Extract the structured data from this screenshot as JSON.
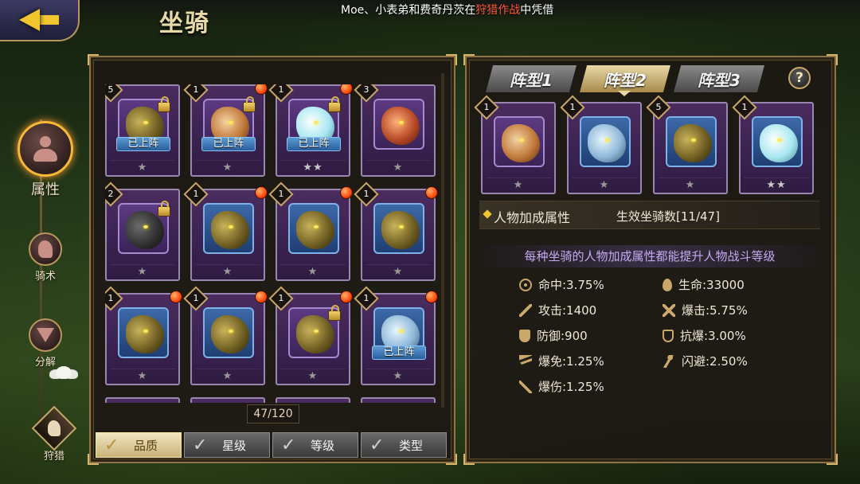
{
  "header": {
    "title": "坐骑",
    "marquee_parts": [
      "Moe、小表弟和费奇丹茨在",
      "狩猎作战",
      "中凭借"
    ]
  },
  "left_nav": [
    {
      "label": "属性",
      "icon": "person-icon",
      "active": true
    },
    {
      "label": "骑术",
      "icon": "horse-head-icon",
      "active": false
    },
    {
      "label": "分解",
      "icon": "decompose-icon",
      "active": false
    },
    {
      "label": "狩猎",
      "icon": "hunt-icon",
      "active": false
    }
  ],
  "mount_list": {
    "count": "47/120",
    "deployed_label": "已上阵",
    "cards": [
      {
        "level": "5",
        "beast": "dragon",
        "lock": true,
        "deployed": true,
        "red_dot": false,
        "stars": "★"
      },
      {
        "level": "1",
        "beast": "tiger",
        "lock": true,
        "deployed": true,
        "red_dot": true,
        "stars": "★"
      },
      {
        "level": "1",
        "beast": "unicorn",
        "lock": true,
        "deployed": true,
        "red_dot": true,
        "stars": "★★"
      },
      {
        "level": "3",
        "beast": "phoenix",
        "lock": false,
        "deployed": false,
        "red_dot": false,
        "stars": "★"
      },
      {
        "level": "2",
        "beast": "dragon-dark",
        "lock": true,
        "deployed": false,
        "red_dot": false,
        "stars": "★"
      },
      {
        "level": "1",
        "beast": "dragon",
        "lock": false,
        "deployed": false,
        "red_dot": true,
        "stars": "★"
      },
      {
        "level": "1",
        "beast": "dragon",
        "lock": false,
        "deployed": false,
        "red_dot": true,
        "stars": "★"
      },
      {
        "level": "1",
        "beast": "dragon",
        "lock": false,
        "deployed": false,
        "red_dot": true,
        "stars": "★"
      },
      {
        "level": "1",
        "beast": "dragon",
        "lock": false,
        "deployed": false,
        "red_dot": true,
        "stars": "★"
      },
      {
        "level": "1",
        "beast": "dragon",
        "lock": false,
        "deployed": false,
        "red_dot": true,
        "stars": "★"
      },
      {
        "level": "1",
        "beast": "dragon",
        "lock": true,
        "deployed": false,
        "red_dot": true,
        "stars": "★"
      },
      {
        "level": "1",
        "beast": "ice",
        "lock": false,
        "deployed": true,
        "red_dot": true,
        "stars": "★"
      }
    ]
  },
  "filters": [
    {
      "label": "品质",
      "active": true
    },
    {
      "label": "星级",
      "active": false
    },
    {
      "label": "等级",
      "active": false
    },
    {
      "label": "类型",
      "active": false
    }
  ],
  "formation": {
    "tabs": [
      {
        "label": "阵型1",
        "active": false
      },
      {
        "label": "阵型2",
        "active": true
      },
      {
        "label": "阵型3",
        "active": false
      }
    ],
    "help": "?",
    "slots": [
      {
        "level": "1",
        "beast": "tiger",
        "stars": "★"
      },
      {
        "level": "1",
        "beast": "ice",
        "stars": "★"
      },
      {
        "level": "5",
        "beast": "dragon",
        "stars": "★"
      },
      {
        "level": "1",
        "beast": "unicorn",
        "stars": "★★"
      }
    ]
  },
  "bonus": {
    "section_title": "人物加成属性",
    "effective_count": "生效坐骑数[11/47]",
    "description": "每种坐骑的人物加成属性都能提升人物战斗等级",
    "stats": [
      {
        "icon": "target-icon",
        "text": "命中:3.75%"
      },
      {
        "icon": "life-drop-icon",
        "text": "生命:33000"
      },
      {
        "icon": "sword-icon",
        "text": "攻击:1400"
      },
      {
        "icon": "crossed-swords-icon",
        "text": "爆击:5.75%"
      },
      {
        "icon": "shield-icon",
        "text": "防御:900"
      },
      {
        "icon": "shield-outline-icon",
        "text": "抗爆:3.00%"
      },
      {
        "icon": "wing-icon",
        "text": "爆免:1.25%"
      },
      {
        "icon": "dodge-runner-icon",
        "text": "闪避:2.50%"
      },
      {
        "icon": "blade-icon",
        "text": "爆伤:1.25%"
      }
    ]
  },
  "colors": {
    "accent_gold": "#c9a86a",
    "notice_highlight": "#ff5a3c",
    "description_purple": "#c5aaf0"
  }
}
